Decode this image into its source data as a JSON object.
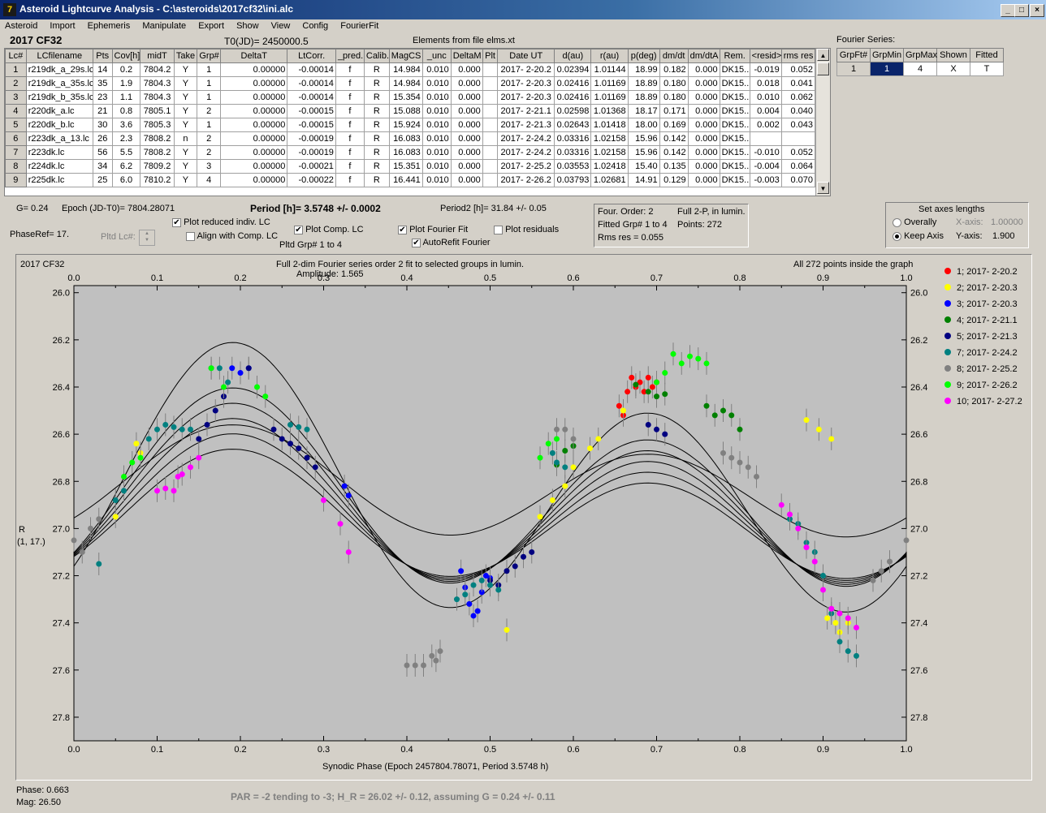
{
  "window": {
    "title": "Asteroid Lightcurve Analysis - C:\\asteroids\\2017cf32\\ini.alc",
    "icon": "app-icon",
    "controls": [
      "_",
      "□",
      "×"
    ]
  },
  "menu": [
    "Asteroid",
    "Import",
    "Ephemeris",
    "Manipulate",
    "Export",
    "Show",
    "View",
    "Config",
    "FourierFit"
  ],
  "header": {
    "object": "2017 CF32",
    "t0": "T0(JD)= 2450000.5",
    "elements": "Elements from file elms.xt"
  },
  "table": {
    "columns": [
      "Lc#",
      "LCfilename",
      "Pts",
      "Cov[h]",
      "midT",
      "Take",
      "Grp#",
      "DeltaT",
      "LtCorr.",
      "_pred.",
      "Calib.",
      "MagCS",
      "_unc",
      "DeltaM",
      "Plt",
      "Date UT",
      "d(au)",
      "r(au)",
      "p(deg)",
      "dm/dt",
      "dm/dtA",
      "Rem.",
      "<resid>",
      "rms res"
    ],
    "rows": [
      [
        "1",
        "r219dk_a_29s.lc",
        "14",
        "0.2",
        "7804.2",
        "Y",
        "1",
        "0.00000",
        "-0.00014",
        "f",
        "R",
        "14.984",
        "0.010",
        "0.000",
        "",
        "2017- 2-20.2",
        "0.02394",
        "1.01144",
        "18.99",
        "0.182",
        "0.000",
        "DK15...",
        "-0.019",
        "0.052"
      ],
      [
        "2",
        "r219dk_a_35s.lc",
        "35",
        "1.9",
        "7804.3",
        "Y",
        "1",
        "0.00000",
        "-0.00014",
        "f",
        "R",
        "14.984",
        "0.010",
        "0.000",
        "",
        "2017- 2-20.3",
        "0.02416",
        "1.01169",
        "18.89",
        "0.180",
        "0.000",
        "DK15...",
        "0.018",
        "0.041"
      ],
      [
        "3",
        "r219dk_b_35s.lc",
        "23",
        "1.1",
        "7804.3",
        "Y",
        "1",
        "0.00000",
        "-0.00014",
        "f",
        "R",
        "15.354",
        "0.010",
        "0.000",
        "",
        "2017- 2-20.3",
        "0.02416",
        "1.01169",
        "18.89",
        "0.180",
        "0.000",
        "DK15...",
        "0.010",
        "0.062"
      ],
      [
        "4",
        "r220dk_a.lc",
        "21",
        "0.8",
        "7805.1",
        "Y",
        "2",
        "0.00000",
        "-0.00015",
        "f",
        "R",
        "15.088",
        "0.010",
        "0.000",
        "",
        "2017- 2-21.1",
        "0.02598",
        "1.01368",
        "18.17",
        "0.171",
        "0.000",
        "DK15...",
        "0.004",
        "0.040"
      ],
      [
        "5",
        "r220dk_b.lc",
        "30",
        "3.6",
        "7805.3",
        "Y",
        "1",
        "0.00000",
        "-0.00015",
        "f",
        "R",
        "15.924",
        "0.010",
        "0.000",
        "",
        "2017- 2-21.3",
        "0.02643",
        "1.01418",
        "18.00",
        "0.169",
        "0.000",
        "DK15...",
        "0.002",
        "0.043"
      ],
      [
        "6",
        "r223dk_a_13.lc",
        "26",
        "2.3",
        "7808.2",
        "n",
        "2",
        "0.00000",
        "-0.00019",
        "f",
        "R",
        "16.083",
        "0.010",
        "0.000",
        "",
        "2017- 2-24.2",
        "0.03316",
        "1.02158",
        "15.96",
        "0.142",
        "0.000",
        "DK15...",
        "",
        ""
      ],
      [
        "7",
        "r223dk.lc",
        "56",
        "5.5",
        "7808.2",
        "Y",
        "2",
        "0.00000",
        "-0.00019",
        "f",
        "R",
        "16.083",
        "0.010",
        "0.000",
        "",
        "2017- 2-24.2",
        "0.03316",
        "1.02158",
        "15.96",
        "0.142",
        "0.000",
        "DK15...",
        "-0.010",
        "0.052"
      ],
      [
        "8",
        "r224dk.lc",
        "34",
        "6.2",
        "7809.2",
        "Y",
        "3",
        "0.00000",
        "-0.00021",
        "f",
        "R",
        "15.351",
        "0.010",
        "0.000",
        "",
        "2017- 2-25.2",
        "0.03553",
        "1.02418",
        "15.40",
        "0.135",
        "0.000",
        "DK15...",
        "-0.004",
        "0.064"
      ],
      [
        "9",
        "r225dk.lc",
        "25",
        "6.0",
        "7810.2",
        "Y",
        "4",
        "0.00000",
        "-0.00022",
        "f",
        "R",
        "16.441",
        "0.010",
        "0.000",
        "",
        "2017- 2-26.2",
        "0.03793",
        "1.02681",
        "14.91",
        "0.129",
        "0.000",
        "DK15...",
        "-0.003",
        "0.070"
      ]
    ]
  },
  "fourier_series": {
    "label": "Fourier Series:",
    "columns": [
      "GrpFt#",
      "GrpMin",
      "GrpMax",
      "Shown",
      "Fitted"
    ],
    "row": [
      "1",
      "1",
      "4",
      "X",
      "T"
    ]
  },
  "params": {
    "g": "G= 0.24",
    "epoch": "Epoch (JD-T0)= 7804.28071",
    "period": "Period [h]= 3.5748 +/- 0.0002",
    "period2": "Period2 [h]= 31.84 +/- 0.05",
    "phaseref": "PhaseRef= 17.",
    "pltd_lc": "Pltd Lc#:",
    "pltd_grp": "Pltd Grp#  1   to   4"
  },
  "checks": {
    "reduced": {
      "label": "Plot reduced indiv. LC",
      "checked": true
    },
    "align": {
      "label": "Align with Comp. LC",
      "checked": false
    },
    "comp": {
      "label": "Plot Comp. LC",
      "checked": true
    },
    "fourier": {
      "label": "Plot Fourier Fit",
      "checked": true
    },
    "autorefit": {
      "label": "AutoRefit Fourier",
      "checked": true
    },
    "residuals": {
      "label": "Plot residuals",
      "checked": false
    }
  },
  "fit_info": {
    "order": "Four. Order:  2",
    "full2p": "Full 2-P, in lumin.",
    "fitted": "Fitted Grp# 1 to 4",
    "points": "Points: 272",
    "rms": "Rms res      = 0.055"
  },
  "axes_panel": {
    "title": "Set axes lengths",
    "overally": "Overally",
    "keep": "Keep Axis",
    "x_label": "X-axis:",
    "x_value": "1.00000",
    "y_label": "Y-axis:",
    "y_value": "1.900"
  },
  "plot": {
    "object": "2017 CF32",
    "title": "Full 2-dim Fourier series order 2 fit to selected groups in lumin.",
    "amplitude": "Amplitude: 1.565",
    "inside": "All 272 points inside the graph",
    "ylabel1": "R",
    "ylabel2": "(1, 17.)",
    "xlabel": "Synodic Phase (Epoch 2457804.78071, Period 3.5748 h)",
    "xticks": [
      "0.0",
      "0.1",
      "0.2",
      "0.3",
      "0.4",
      "0.5",
      "0.6",
      "0.7",
      "0.8",
      "0.9",
      "1.0"
    ],
    "yticks": [
      "26.0",
      "26.2",
      "26.4",
      "26.6",
      "26.8",
      "27.0",
      "27.2",
      "27.4",
      "27.6",
      "27.8"
    ]
  },
  "chart_data": {
    "type": "scatter",
    "title": "Full 2-dim Fourier series order 2 fit to selected groups in lumin.",
    "xlabel": "Synodic Phase (Epoch 2457804.78071, Period 3.5748 h)",
    "ylabel": "R (1, 17.)",
    "xlim": [
      0.0,
      1.0
    ],
    "ylim": [
      27.9,
      25.97
    ],
    "y_inverted": true,
    "grid": false,
    "legend_position": "right",
    "fourier": {
      "amplitude": 1.565,
      "curve_offsets": [
        0.0,
        0.04,
        0.08,
        0.12,
        0.16,
        0.2,
        -0.04
      ]
    },
    "series": [
      {
        "name": "1; 2017- 2-20.2",
        "color": "#ff0000",
        "x": [
          0.66,
          0.665,
          0.67,
          0.675,
          0.68,
          0.685,
          0.69,
          0.695,
          0.7,
          0.655
        ],
        "y": [
          26.52,
          26.42,
          26.36,
          26.4,
          26.38,
          26.42,
          26.36,
          26.4,
          26.38,
          26.48
        ]
      },
      {
        "name": "2; 2017- 2-20.3",
        "color": "#ffff00",
        "x": [
          0.52,
          0.56,
          0.575,
          0.59,
          0.6,
          0.62,
          0.63,
          0.66,
          0.05,
          0.075,
          0.08,
          0.88,
          0.895,
          0.91,
          0.905,
          0.915,
          0.92,
          0.93
        ],
        "y": [
          27.43,
          26.95,
          26.88,
          26.82,
          26.74,
          26.66,
          26.62,
          26.5,
          26.95,
          26.64,
          26.68,
          26.54,
          26.58,
          26.62,
          27.38,
          27.4,
          27.44,
          27.4
        ]
      },
      {
        "name": "3; 2017- 2-20.3",
        "color": "#0000ff",
        "x": [
          0.465,
          0.47,
          0.475,
          0.48,
          0.485,
          0.49,
          0.495,
          0.5,
          0.19,
          0.2,
          0.21,
          0.325,
          0.33
        ],
        "y": [
          27.18,
          27.25,
          27.32,
          27.37,
          27.35,
          27.27,
          27.2,
          27.21,
          26.32,
          26.34,
          26.32,
          26.82,
          26.86
        ]
      },
      {
        "name": "4; 2017- 2-21.1",
        "color": "#008000",
        "x": [
          0.58,
          0.59,
          0.6,
          0.675,
          0.69,
          0.7,
          0.71,
          0.76,
          0.77,
          0.78,
          0.79,
          0.8
        ],
        "y": [
          26.73,
          26.67,
          26.65,
          26.39,
          26.42,
          26.44,
          26.43,
          26.48,
          26.52,
          26.5,
          26.52,
          26.58
        ]
      },
      {
        "name": "5; 2017- 2-21.3",
        "color": "#000080",
        "x": [
          0.15,
          0.16,
          0.17,
          0.18,
          0.21,
          0.24,
          0.25,
          0.26,
          0.27,
          0.28,
          0.29,
          0.5,
          0.51,
          0.52,
          0.53,
          0.54,
          0.55,
          0.69,
          0.7,
          0.71
        ],
        "y": [
          26.62,
          26.56,
          26.5,
          26.44,
          26.32,
          26.58,
          26.62,
          26.64,
          26.66,
          26.7,
          26.74,
          27.22,
          27.24,
          27.18,
          27.16,
          27.12,
          27.1,
          26.56,
          26.58,
          26.6
        ]
      },
      {
        "name": "7; 2017- 2-24.2",
        "color": "#008080",
        "x": [
          0.03,
          0.05,
          0.06,
          0.09,
          0.1,
          0.11,
          0.12,
          0.13,
          0.14,
          0.165,
          0.175,
          0.185,
          0.26,
          0.27,
          0.28,
          0.46,
          0.47,
          0.48,
          0.49,
          0.5,
          0.51,
          0.575,
          0.58,
          0.59,
          0.86,
          0.87,
          0.88,
          0.89,
          0.9,
          0.91,
          0.92,
          0.93,
          0.94
        ],
        "y": [
          27.15,
          26.88,
          26.84,
          26.62,
          26.58,
          26.56,
          26.57,
          26.58,
          26.58,
          26.32,
          26.32,
          26.38,
          26.56,
          26.57,
          26.58,
          27.3,
          27.28,
          27.24,
          27.22,
          27.24,
          27.26,
          26.68,
          26.72,
          26.74,
          26.96,
          26.98,
          27.06,
          27.1,
          27.2,
          27.36,
          27.48,
          27.52,
          27.54
        ]
      },
      {
        "name": "8; 2017- 2-25.2",
        "color": "#808080",
        "x": [
          0.0,
          0.01,
          0.02,
          0.03,
          0.4,
          0.41,
          0.42,
          0.43,
          0.435,
          0.44,
          0.58,
          0.59,
          0.6,
          0.78,
          0.79,
          0.8,
          0.81,
          0.82,
          0.96,
          0.97,
          0.98,
          1.0
        ],
        "y": [
          27.05,
          27.1,
          27.0,
          26.96,
          27.58,
          27.58,
          27.58,
          27.54,
          27.56,
          27.52,
          26.58,
          26.58,
          26.62,
          26.68,
          26.7,
          26.72,
          26.74,
          26.78,
          27.22,
          27.18,
          27.14,
          27.05
        ]
      },
      {
        "name": "9; 2017- 2-26.2",
        "color": "#00ff00",
        "x": [
          0.06,
          0.07,
          0.08,
          0.165,
          0.18,
          0.22,
          0.23,
          0.56,
          0.57,
          0.58,
          0.7,
          0.71,
          0.72,
          0.73,
          0.74,
          0.75,
          0.76
        ],
        "y": [
          26.78,
          26.72,
          26.7,
          26.32,
          26.4,
          26.4,
          26.44,
          26.7,
          26.64,
          26.62,
          26.38,
          26.34,
          26.26,
          26.3,
          26.27,
          26.28,
          26.3
        ]
      },
      {
        "name": "10; 2017- 2-27.2",
        "color": "#ff00ff",
        "x": [
          0.1,
          0.11,
          0.12,
          0.125,
          0.13,
          0.14,
          0.15,
          0.3,
          0.32,
          0.33,
          0.85,
          0.86,
          0.87,
          0.88,
          0.89,
          0.9,
          0.91,
          0.92,
          0.93,
          0.94
        ],
        "y": [
          26.84,
          26.83,
          26.84,
          26.78,
          26.77,
          26.74,
          26.7,
          26.88,
          26.98,
          27.1,
          26.9,
          26.94,
          27.0,
          27.08,
          27.14,
          27.26,
          27.34,
          27.36,
          27.38,
          27.42
        ]
      }
    ]
  },
  "status": {
    "phase": "Phase:  0.663",
    "mag": "Mag:     26.50",
    "par": "PAR = -2 tending to -3; H_R = 26.02 +/- 0.12, assuming G = 0.24 +/- 0.11"
  }
}
